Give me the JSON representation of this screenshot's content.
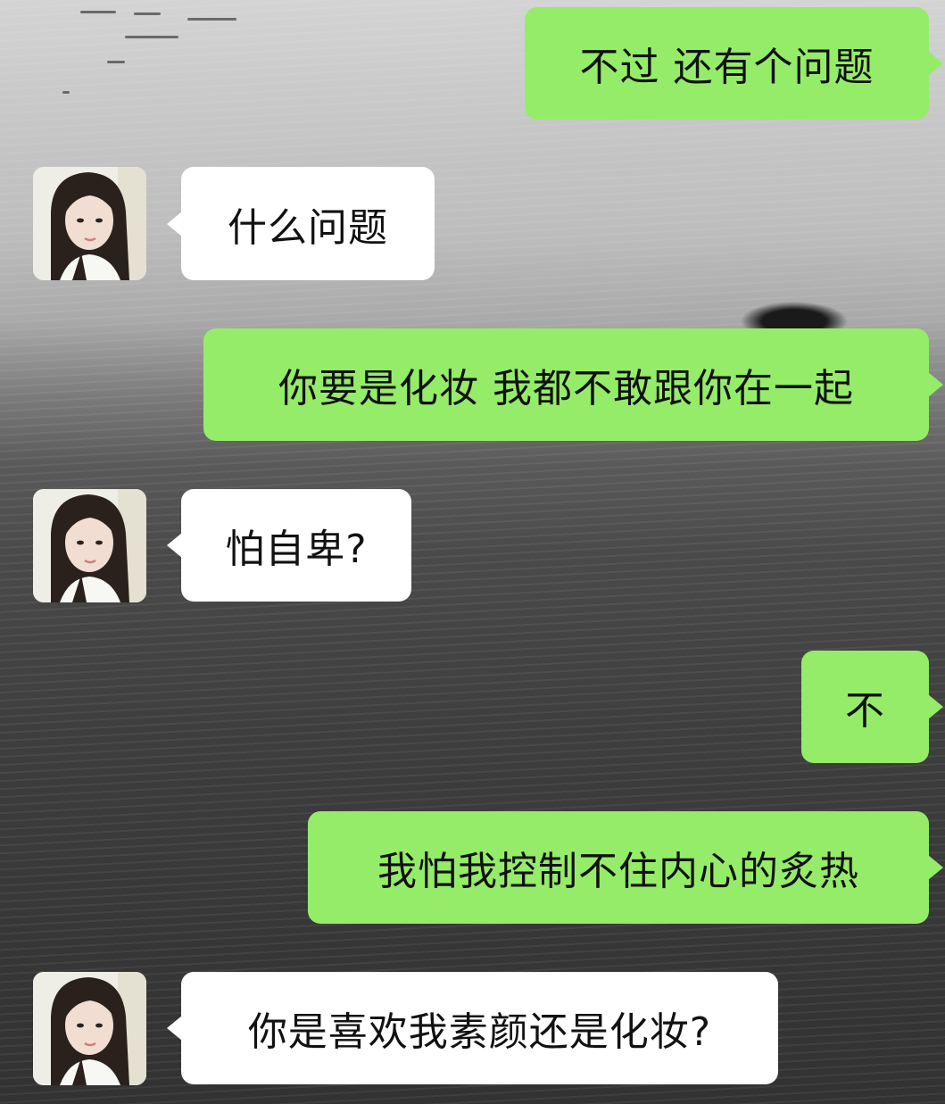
{
  "messages": [
    {
      "sender": "me",
      "text": "不过 还有个问题"
    },
    {
      "sender": "other",
      "text": "什么问题"
    },
    {
      "sender": "me",
      "text": "你要是化妆 我都不敢跟你在一起"
    },
    {
      "sender": "other",
      "text": "怕自卑?"
    },
    {
      "sender": "me",
      "text": "不"
    },
    {
      "sender": "me",
      "text": "我怕我控制不住内心的炙热"
    },
    {
      "sender": "other",
      "text": "你是喜欢我素颜还是化妆?"
    }
  ],
  "colors": {
    "sent_bubble": "#95ec69",
    "received_bubble": "#ffffff",
    "text": "#111111"
  },
  "icons": {
    "avatar": "contact-avatar-portrait"
  }
}
